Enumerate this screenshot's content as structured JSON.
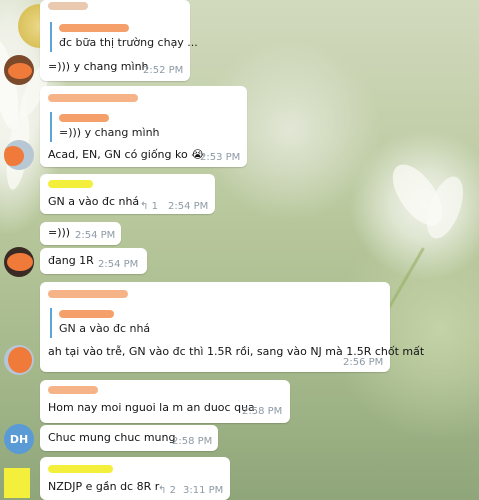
{
  "messages": [
    {
      "quote_text": "đc bữa thị trường chạy ...",
      "text": "=))) y chang mình",
      "time": "2:52 PM"
    },
    {
      "quote_text": "=))) y chang mình",
      "text": "Acad, EN, GN có giống ko 😭",
      "time": "2:53 PM"
    },
    {
      "text": "GN a vào đc nhá",
      "reply_count": "1",
      "time": "2:54 PM"
    },
    {
      "text": "=)))",
      "time": "2:54 PM"
    },
    {
      "text": "đang 1R",
      "time": "2:54 PM"
    },
    {
      "quote_text": "GN a vào đc nhá",
      "text": "ah tại vào trễ, GN vào đc thì 1.5R rồi, sang vào NJ mà 1.5R chốt mất",
      "time": "2:56 PM"
    },
    {
      "text": "Hom nay moi nguoi la m an duoc qua",
      "time": "2:58 PM"
    },
    {
      "text": "Chuc mung chuc mung",
      "time": "2:58 PM",
      "avatar_initials": "DH"
    },
    {
      "text": "NZDJP e gần dc 8R r",
      "reply_count": "2",
      "time": "3:11 PM"
    }
  ],
  "colors": {
    "bubble": "#ffffff",
    "quote_bar": "#5aa6d8",
    "time": "#8d9aa5",
    "avatar_dh": "#5b9bd5",
    "redaction_orange": "#f5a06a",
    "redaction_yellow": "#f3ef3a"
  },
  "icons": {
    "reply": "reply-arrow-icon"
  }
}
